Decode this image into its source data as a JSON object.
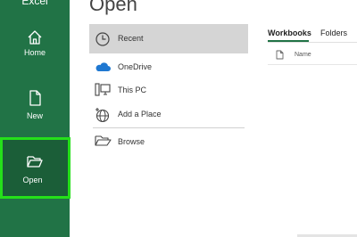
{
  "app": {
    "title": "Excel"
  },
  "sidebar": {
    "items": [
      {
        "label": "Home"
      },
      {
        "label": "New"
      },
      {
        "label": "Open"
      }
    ]
  },
  "main": {
    "title": "Open",
    "locations": [
      {
        "label": "Recent"
      },
      {
        "label": "OneDrive"
      },
      {
        "label": "This PC"
      },
      {
        "label": "Add a Place"
      },
      {
        "label": "Browse"
      }
    ],
    "tabs": [
      {
        "label": "Workbooks"
      },
      {
        "label": "Folders"
      }
    ],
    "columns": {
      "name": "Name"
    }
  },
  "colors": {
    "brand": "#217346",
    "selected_nav": "#1b5e38",
    "highlight": "#25e01a",
    "selected_location": "#d5d5d5"
  }
}
